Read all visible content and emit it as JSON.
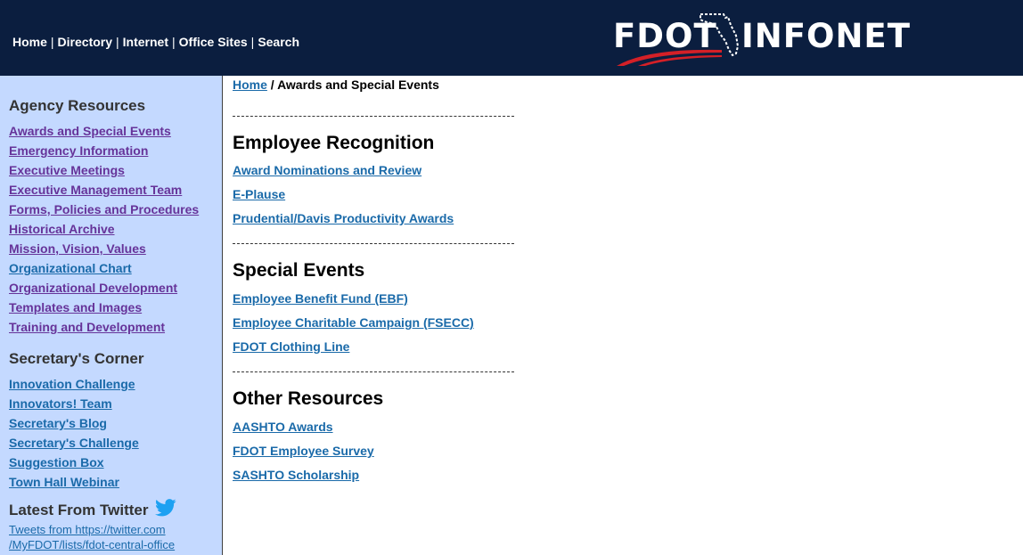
{
  "header": {
    "nav": [
      "Home",
      "Directory",
      "Internet",
      "Office Sites",
      "Search"
    ],
    "nav_separator": "|",
    "logo": {
      "left": "FDOT",
      "right": "INFONET"
    }
  },
  "sidebar": {
    "agency_resources": {
      "heading": "Agency Resources",
      "items": [
        "Awards and Special Events",
        "Emergency Information",
        "Executive Meetings",
        "Executive Management Team",
        "Forms, Policies and Procedures",
        "Historical Archive",
        "Mission, Vision, Values",
        "Organizational Chart",
        "Organizational Development",
        "Templates and Images",
        "Training and Development"
      ]
    },
    "secretarys_corner": {
      "heading": "Secretary's Corner",
      "items": [
        "Innovation Challenge",
        "Innovators! Team",
        "Secretary's Blog",
        "Secretary's Challenge",
        "Suggestion Box",
        "Town Hall Webinar"
      ]
    },
    "twitter": {
      "heading": "Latest From Twitter",
      "link_line1": "Tweets from https://twitter.com",
      "link_line2": "/MyFDOT/lists/fdot-central-office"
    }
  },
  "breadcrumb": {
    "home": "Home",
    "separator": "/",
    "current": "Awards and Special Events"
  },
  "sections": [
    {
      "heading": "Employee Recognition",
      "links": [
        "Award Nominations and Review",
        "E-Plause",
        "Prudential/Davis Productivity Awards"
      ]
    },
    {
      "heading": "Special Events",
      "links": [
        "Employee Benefit Fund (EBF)",
        "Employee Charitable Campaign (FSECC)",
        "FDOT Clothing Line"
      ]
    },
    {
      "heading": "Other Resources",
      "links": [
        "AASHTO Awards",
        "FDOT Employee Survey",
        "SASHTO Scholarship"
      ]
    }
  ],
  "colors": {
    "header_bg": "#0b1e3f",
    "sidebar_bg": "#c4d9ff",
    "link": "#1a6aa9",
    "visited_link": "#663399",
    "logo_red": "#d42027",
    "twitter_blue": "#1da1f2"
  },
  "icons": {
    "logo_mark": "florida-state-outline",
    "twitter": "twitter-bird-icon"
  }
}
